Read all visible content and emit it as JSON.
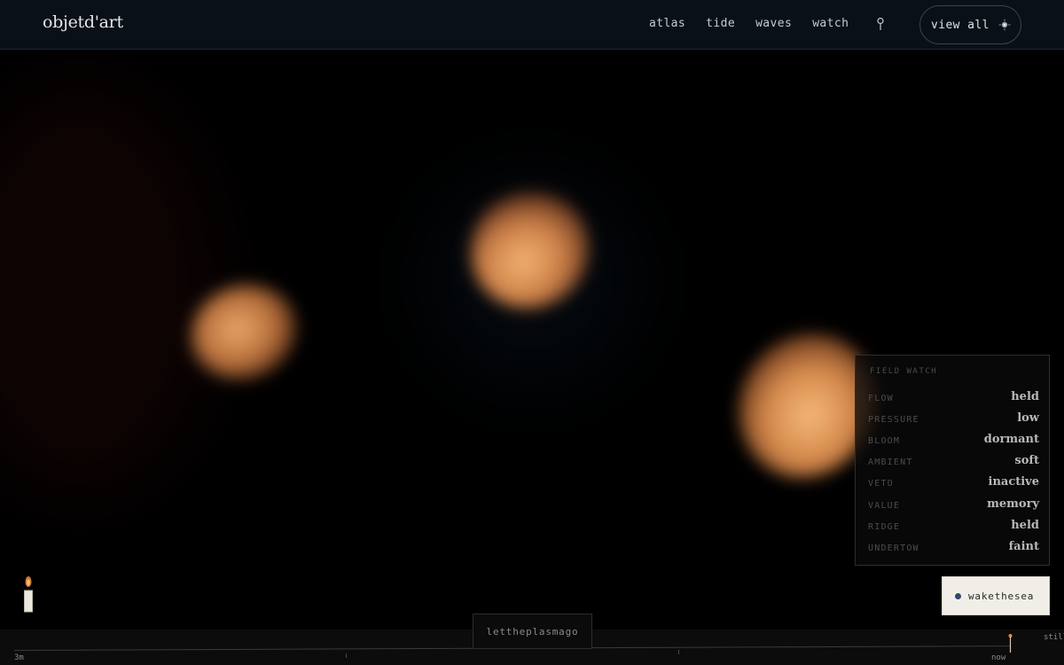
{
  "header": {
    "logo": "objetd'art",
    "nav": [
      "atlas",
      "tide",
      "waves",
      "watch"
    ],
    "view_all_label": "view all"
  },
  "icons": {
    "pin": "location-pin-icon",
    "sparkle": "sparkle-icon",
    "candle": "candle-icon"
  },
  "colors": {
    "accent": "#e58a46",
    "header_bg": "#0a1017",
    "wake_bg": "#f1eee8",
    "wake_dot": "#2d4a6a"
  },
  "field_watch": {
    "title": "FIELD WATCH",
    "rows": [
      {
        "key": "FLOW",
        "value": "held"
      },
      {
        "key": "PRESSURE",
        "value": "low"
      },
      {
        "key": "BLOOM",
        "value": "dormant"
      },
      {
        "key": "AMBIENT",
        "value": "soft"
      },
      {
        "key": "VETO",
        "value": "inactive"
      },
      {
        "key": "VALUE",
        "value": "memory"
      },
      {
        "key": "RIDGE",
        "value": "held"
      },
      {
        "key": "UNDERTOW",
        "value": "faint"
      }
    ]
  },
  "wake_button_label": "wakethesea",
  "plasma_button_label": "lettheplasmago",
  "timeline": {
    "start_label": "3m",
    "end_label": "now",
    "right_label": "still"
  }
}
